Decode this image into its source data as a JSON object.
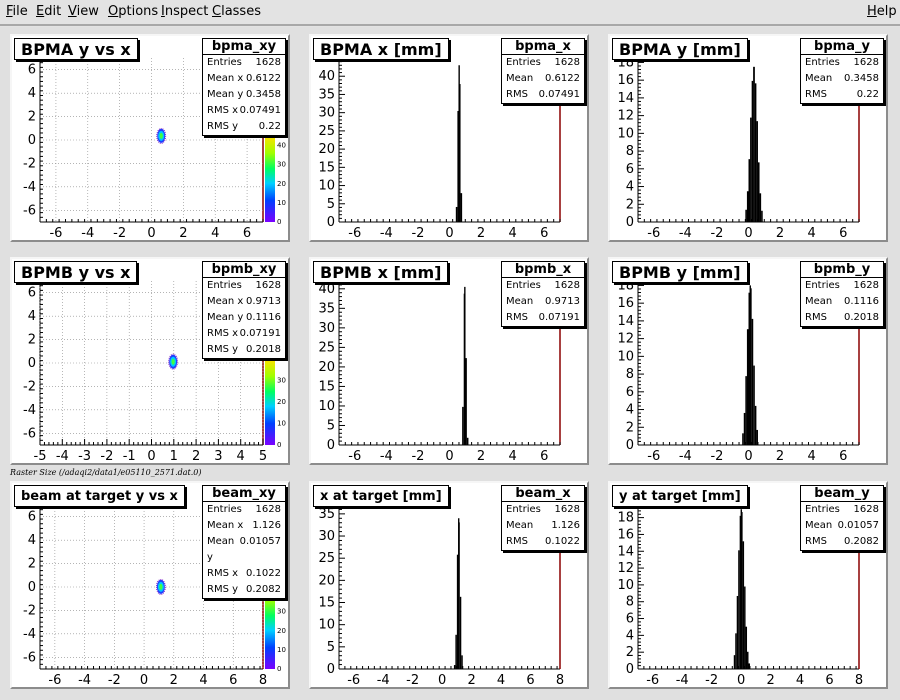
{
  "menu": [
    {
      "label": "File",
      "accel": "F"
    },
    {
      "label": "Edit",
      "accel": "E"
    },
    {
      "label": "View",
      "accel": "V"
    },
    {
      "label": "Options",
      "accel": "O"
    },
    {
      "label": "Inspect",
      "accel": "I"
    },
    {
      "label": "Classes",
      "accel": "C"
    }
  ],
  "help": {
    "label": "Help",
    "accel": "H"
  },
  "raster_note": "Raster Size (/adaqi2/data1/e05110_2571.dat.0)",
  "pads": [
    {
      "title": "BPMA y vs x",
      "hist": "bpma_xy",
      "stats": [
        [
          "Entries",
          "1628"
        ],
        [
          "Mean x",
          "0.6122"
        ],
        [
          "Mean y",
          "0.3458"
        ],
        [
          "RMS x",
          "0.07491"
        ],
        [
          "RMS y",
          "0.22"
        ]
      ]
    },
    {
      "title": "BPMA x [mm]",
      "hist": "bpma_x",
      "stats": [
        [
          "Entries",
          "1628"
        ],
        [
          "Mean",
          "0.6122"
        ],
        [
          "RMS",
          "0.07491"
        ]
      ]
    },
    {
      "title": "BPMA y [mm]",
      "hist": "bpma_y",
      "stats": [
        [
          "Entries",
          "1628"
        ],
        [
          "Mean",
          "0.3458"
        ],
        [
          "RMS",
          "0.22"
        ]
      ]
    },
    {
      "title": "BPMB y vs x",
      "hist": "bpmb_xy",
      "stats": [
        [
          "Entries",
          "1628"
        ],
        [
          "Mean x",
          "0.9713"
        ],
        [
          "Mean y",
          "0.1116"
        ],
        [
          "RMS x",
          "0.07191"
        ],
        [
          "RMS y",
          "0.2018"
        ]
      ]
    },
    {
      "title": "BPMB x [mm]",
      "hist": "bpmb_x",
      "stats": [
        [
          "Entries",
          "1628"
        ],
        [
          "Mean",
          "0.9713"
        ],
        [
          "RMS",
          "0.07191"
        ]
      ]
    },
    {
      "title": "BPMB y [mm]",
      "hist": "bpmb_y",
      "stats": [
        [
          "Entries",
          "1628"
        ],
        [
          "Mean",
          "0.1116"
        ],
        [
          "RMS",
          "0.2018"
        ]
      ]
    },
    {
      "title": "beam at target y vs x",
      "hist": "beam_xy",
      "stats": [
        [
          "Entries",
          "1628"
        ],
        [
          "Mean x",
          "1.126"
        ],
        [
          "Mean y",
          "0.01057"
        ],
        [
          "RMS x",
          "0.1022"
        ],
        [
          "RMS y",
          "0.2082"
        ]
      ]
    },
    {
      "title": "x at target [mm]",
      "hist": "beam_x",
      "stats": [
        [
          "Entries",
          "1628"
        ],
        [
          "Mean",
          "1.126"
        ],
        [
          "RMS",
          "0.1022"
        ]
      ]
    },
    {
      "title": "y at target [mm]",
      "hist": "beam_y",
      "stats": [
        [
          "Entries",
          "1628"
        ],
        [
          "Mean",
          "0.01057"
        ],
        [
          "RMS",
          "0.2082"
        ]
      ]
    }
  ],
  "chart_data": [
    {
      "type": "heatmap",
      "title": "BPMA y vs x",
      "xlim": [
        -7,
        7
      ],
      "ylim": [
        -7,
        7
      ],
      "xticks": [
        -6,
        -4,
        -2,
        0,
        2,
        4,
        6
      ],
      "yticks": [
        -6,
        -4,
        -2,
        0,
        2,
        4,
        6
      ],
      "zticks": [
        0,
        10,
        20,
        30,
        40
      ],
      "zmax": 45,
      "points": [
        {
          "x": 0.61,
          "y": 0.35
        }
      ]
    },
    {
      "type": "bar",
      "title": "BPMA x [mm]",
      "xlim": [
        -7,
        7
      ],
      "ylim": [
        0,
        45
      ],
      "xticks": [
        -6,
        -4,
        -2,
        0,
        2,
        4,
        6
      ],
      "yticks": [
        0,
        5,
        10,
        15,
        20,
        25,
        30,
        35,
        40
      ],
      "hist": {
        "mean": 0.6122,
        "rms": 0.07491,
        "peak": 43
      }
    },
    {
      "type": "bar",
      "title": "BPMA y [mm]",
      "xlim": [
        -7,
        7
      ],
      "ylim": [
        0,
        18.5
      ],
      "xticks": [
        -6,
        -4,
        -2,
        0,
        2,
        4,
        6
      ],
      "yticks": [
        0,
        2,
        4,
        6,
        8,
        10,
        12,
        14,
        16,
        18
      ],
      "hist": {
        "mean": 0.3458,
        "rms": 0.22,
        "peak": 17.5
      }
    },
    {
      "type": "heatmap",
      "title": "BPMB y vs x",
      "xlim": [
        -5,
        5
      ],
      "ylim": [
        -7,
        7
      ],
      "xticks": [
        -5,
        -4,
        -3,
        -2,
        -1,
        0,
        1,
        2,
        3,
        4,
        5
      ],
      "yticks": [
        -6,
        -4,
        -2,
        0,
        2,
        4,
        6
      ],
      "zticks": [
        0,
        10,
        20,
        30
      ],
      "zmax": 40,
      "points": [
        {
          "x": 0.97,
          "y": 0.11
        }
      ]
    },
    {
      "type": "bar",
      "title": "BPMB x [mm]",
      "xlim": [
        -7,
        7
      ],
      "ylim": [
        0,
        42
      ],
      "xticks": [
        -6,
        -4,
        -2,
        0,
        2,
        4,
        6
      ],
      "yticks": [
        0,
        5,
        10,
        15,
        20,
        25,
        30,
        35,
        40
      ],
      "hist": {
        "mean": 0.9713,
        "rms": 0.07191,
        "peak": 40.5
      }
    },
    {
      "type": "bar",
      "title": "BPMB y [mm]",
      "xlim": [
        -7,
        7
      ],
      "ylim": [
        0,
        18.5
      ],
      "xticks": [
        -6,
        -4,
        -2,
        0,
        2,
        4,
        6
      ],
      "yticks": [
        0,
        2,
        4,
        6,
        8,
        10,
        12,
        14,
        16,
        18
      ],
      "hist": {
        "mean": 0.1116,
        "rms": 0.2018,
        "peak": 18
      }
    },
    {
      "type": "heatmap",
      "title": "beam at target y vs x",
      "xlim": [
        -7,
        8
      ],
      "ylim": [
        -7,
        7
      ],
      "xticks": [
        -6,
        -4,
        -2,
        0,
        2,
        4,
        6,
        8
      ],
      "yticks": [
        -6,
        -4,
        -2,
        0,
        2,
        4,
        6
      ],
      "zticks": [
        0,
        10,
        20,
        30,
        40
      ],
      "zmax": 45,
      "points": [
        {
          "x": 1.13,
          "y": 0.01
        }
      ]
    },
    {
      "type": "bar",
      "title": "x at target [mm]",
      "xlim": [
        -7,
        8
      ],
      "ylim": [
        0,
        37
      ],
      "xticks": [
        -6,
        -4,
        -2,
        0,
        2,
        4,
        6,
        8
      ],
      "yticks": [
        0,
        5,
        10,
        15,
        20,
        25,
        30,
        35
      ],
      "hist": {
        "mean": 1.126,
        "rms": 0.1022,
        "peak": 34
      }
    },
    {
      "type": "bar",
      "title": "y at target [mm]",
      "xlim": [
        -7,
        8
      ],
      "ylim": [
        0,
        19.5
      ],
      "xticks": [
        -6,
        -4,
        -2,
        0,
        2,
        4,
        6,
        8
      ],
      "yticks": [
        0,
        2,
        4,
        6,
        8,
        10,
        12,
        14,
        16,
        18
      ],
      "hist": {
        "mean": 0.01057,
        "rms": 0.2082,
        "peak": 19
      }
    }
  ]
}
